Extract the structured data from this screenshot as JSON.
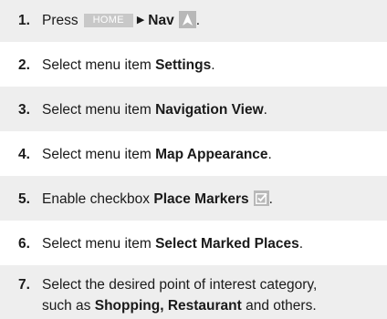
{
  "steps": [
    {
      "number": "1.",
      "press_label": "Press",
      "home_key": "HOME",
      "arrow": "▶",
      "nav_label": "Nav",
      "period": "."
    },
    {
      "number": "2.",
      "text": "Select menu item ",
      "bold": "Settings",
      "period": "."
    },
    {
      "number": "3.",
      "text": "Select menu item ",
      "bold": "Navigation View",
      "period": "."
    },
    {
      "number": "4.",
      "text": "Select menu item ",
      "bold": "Map Appearance",
      "period": "."
    },
    {
      "number": "5.",
      "text": "Enable checkbox ",
      "bold": "Place Markers",
      "period": "."
    },
    {
      "number": "6.",
      "text": "Select menu item ",
      "bold": "Select Marked Places",
      "period": "."
    },
    {
      "number": "7.",
      "line1": "Select the desired point of interest category,",
      "line2_prefix": "such as ",
      "bold1": "Shopping",
      "comma": ", ",
      "bold2": "Restaurant",
      "line2_suffix": " and others."
    }
  ]
}
